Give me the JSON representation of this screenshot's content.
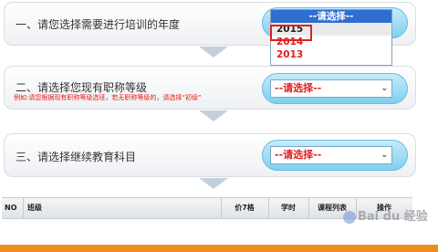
{
  "steps": [
    {
      "title": "一、请您选择需要进行培训的年度"
    },
    {
      "title": "二、请选择您现有职称等级",
      "note": "例如:请您根据现有职称等级选班，若无职称等级的，请选择“初级”"
    },
    {
      "title": "三、请选择继续教育科目"
    }
  ],
  "year_select": {
    "placeholder": "--请选择--",
    "options": [
      "2015",
      "2014",
      "2013"
    ],
    "highlighted": "2015"
  },
  "level_select": {
    "value": "--请选择--"
  },
  "subject_select": {
    "value": "--请选择--"
  },
  "table": {
    "headers": [
      "NO",
      "班级",
      "价7格",
      "学时",
      "课程列表",
      "操作"
    ]
  },
  "watermark": "Bai du 经验",
  "colors": {
    "accent_red": "#e02020",
    "dropdown_blue": "#2f6dd0",
    "pill_blue": "#7ccfee",
    "footer_orange": "#f08c1e"
  }
}
